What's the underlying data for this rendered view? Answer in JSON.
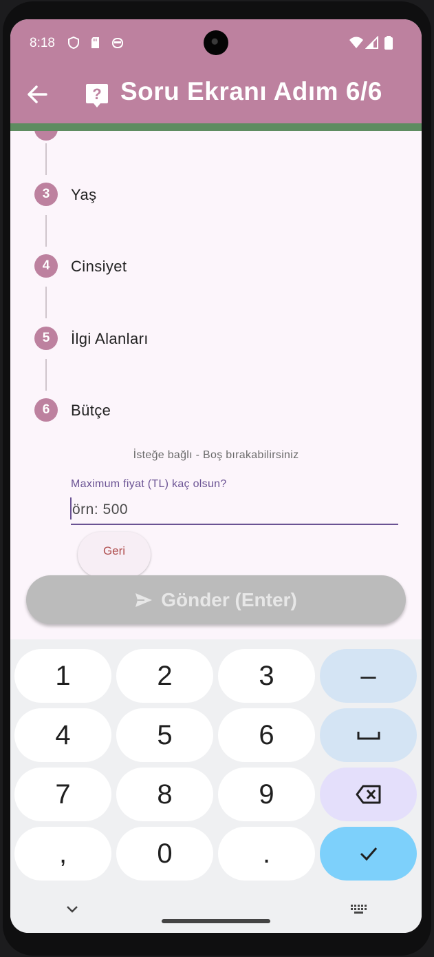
{
  "status_bar": {
    "time": "8:18",
    "icons": [
      "shield-icon",
      "sd-card-icon",
      "robot-icon",
      "wifi-icon",
      "signal-icon",
      "battery-icon"
    ]
  },
  "app_bar": {
    "title": "Soru Ekranı Adım 6/6",
    "back_icon": "arrow-left-icon",
    "help_icon": "help-bubble-icon",
    "color": "#bd819f"
  },
  "progress": {
    "value": 1.0,
    "color": "#5e8c60"
  },
  "steps": [
    {
      "number": "3",
      "label": "Yaş"
    },
    {
      "number": "4",
      "label": "Cinsiyet"
    },
    {
      "number": "5",
      "label": "İlgi Alanları"
    },
    {
      "number": "6",
      "label": "Bütçe"
    }
  ],
  "budget_step": {
    "hint": "İsteğe bağlı - Boş bırakabilirsiniz",
    "field_label": "Maximum fiyat (TL) kaç olsun?",
    "placeholder": "örn: 500",
    "value": "",
    "back_label": "Geri"
  },
  "send_button": {
    "label": "Gönder (Enter)",
    "icon": "send-icon",
    "enabled": false
  },
  "keyboard": {
    "rows": [
      [
        "1",
        "2",
        "3",
        "–"
      ],
      [
        "4",
        "5",
        "6",
        "␣"
      ],
      [
        "7",
        "8",
        "9",
        "⌫"
      ],
      [
        ",",
        "0",
        ".",
        "✓"
      ]
    ],
    "nav": [
      "chevron-down-icon",
      "keyboard-icon"
    ]
  }
}
